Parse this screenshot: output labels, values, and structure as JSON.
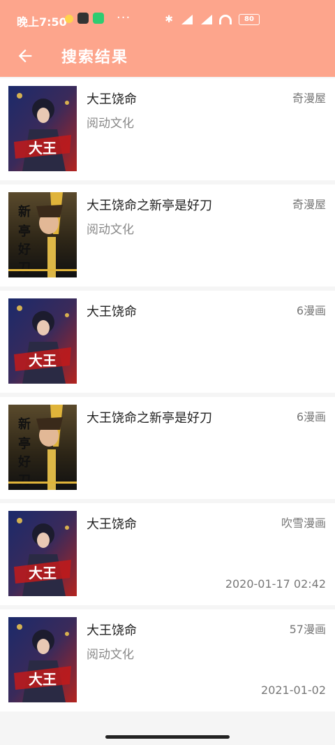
{
  "status_bar": {
    "time": "晚上7:50",
    "more": "···",
    "battery": "80"
  },
  "header": {
    "title": "搜索结果"
  },
  "results": [
    {
      "title": "大王饶命",
      "author": "阅动文化",
      "source": "奇漫屋",
      "time": "",
      "cover": "a"
    },
    {
      "title": "大王饶命之新亭是好刀",
      "author": "阅动文化",
      "source": "奇漫屋",
      "time": "",
      "cover": "b"
    },
    {
      "title": "大王饶命",
      "author": "",
      "source": "6漫画",
      "time": "",
      "cover": "a"
    },
    {
      "title": "大王饶命之新亭是好刀",
      "author": "",
      "source": "6漫画",
      "time": "",
      "cover": "b"
    },
    {
      "title": "大王饶命",
      "author": "",
      "source": "吹雪漫画",
      "time": "2020-01-17 02:42",
      "cover": "a"
    },
    {
      "title": "大王饶命",
      "author": "阅动文化",
      "source": "57漫画",
      "time": "2021-01-02",
      "cover": "a"
    }
  ]
}
